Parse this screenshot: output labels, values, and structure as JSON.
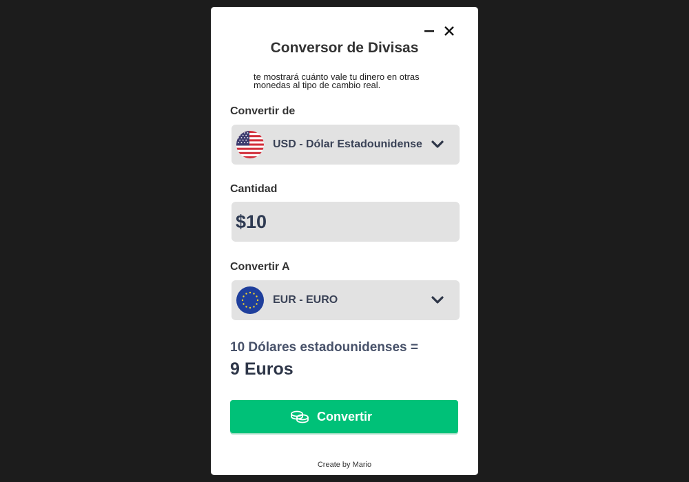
{
  "app": {
    "title": "Conversor de Divisas",
    "subtitle": "te mostrará cuánto vale tu dinero en otras monedas al tipo de cambio real."
  },
  "window_controls": {
    "minimize_icon": "minus-icon",
    "close_icon": "close-icon"
  },
  "from": {
    "label": "Convertir de",
    "selected": "USD - Dólar Estadounidense",
    "flag": "us-flag-icon"
  },
  "amount": {
    "label": "Cantidad",
    "value": "$10"
  },
  "to": {
    "label": "Convertir A",
    "selected": "EUR - EURO",
    "flag": "eu-flag-icon"
  },
  "result": {
    "line1": "10 Dólares estadounidenses =",
    "line2": "9 Euros"
  },
  "convert_button": {
    "label": "Convertir",
    "icon": "coins-icon",
    "color": "#00c178"
  },
  "footer": {
    "text": "Create by Mario"
  }
}
